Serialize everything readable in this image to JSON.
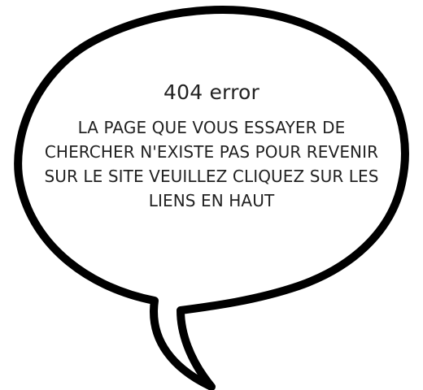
{
  "error": {
    "title": "404 error",
    "message": "LA PAGE QUE VOUS ESSAYER DE CHERCHER N'EXISTE PAS POUR REVENIR SUR LE SITE VEUILLEZ CLIQUEZ SUR LES LIENS EN HAUT"
  },
  "colors": {
    "bubble_fill": "#ffffff",
    "bubble_stroke": "#000000",
    "text": "#222222"
  },
  "icons": {
    "bubble": "speech-bubble-icon"
  }
}
